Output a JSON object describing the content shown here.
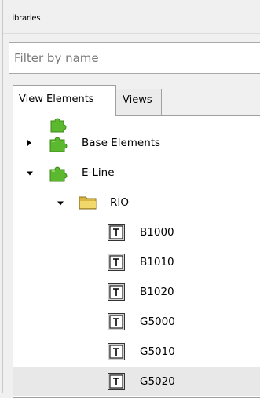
{
  "panel": {
    "title": "Libraries"
  },
  "filter": {
    "placeholder": "Filter by name"
  },
  "tabs": [
    {
      "label": "View Elements",
      "active": true
    },
    {
      "label": "Views",
      "active": false
    }
  ],
  "tree": {
    "base_elements": {
      "label": "Base Elements",
      "expanded": false,
      "icon": "puzzle-piece-icon"
    },
    "e_line": {
      "label": "E-Line",
      "expanded": true,
      "icon": "puzzle-piece-icon"
    },
    "rio": {
      "label": "RIO",
      "expanded": true,
      "icon": "folder-icon"
    },
    "items": [
      {
        "label": "B1000",
        "icon": "text-element-icon"
      },
      {
        "label": "B1010",
        "icon": "text-element-icon"
      },
      {
        "label": "B1020",
        "icon": "text-element-icon"
      },
      {
        "label": "G5000",
        "icon": "text-element-icon"
      },
      {
        "label": "G5010",
        "icon": "text-element-icon"
      },
      {
        "label": "G5020",
        "icon": "text-element-icon",
        "selected": true
      }
    ]
  },
  "colors": {
    "puzzle_green": "#5cb82e",
    "folder_yellow": "#e8c84a",
    "selection": "#e8e8e8"
  }
}
